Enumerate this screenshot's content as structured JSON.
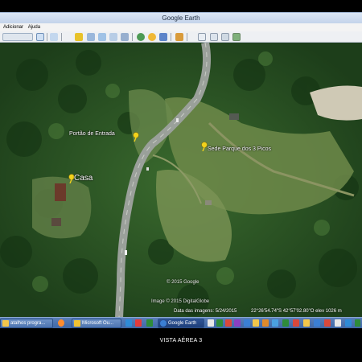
{
  "window": {
    "title": "Google Earth"
  },
  "menu": {
    "items": [
      "Adicionar",
      "Ajuda"
    ]
  },
  "placemarks": {
    "gate": "Portão de Entrada",
    "house": "Casa",
    "hq": "Sede Parque dos 3 Picos"
  },
  "map": {
    "copyright_google": "© 2015 Google",
    "copyright_image": "Image © 2015 DigitalGlobe"
  },
  "status": {
    "imagery_date": "Data das imagens: 5/24/2015",
    "coordinates": "22°26'54.74\"S   42°57'02.80\"O   elev  1026 m"
  },
  "taskbar": {
    "buttons": [
      "atalhos progra...",
      "Microsoft Ou...",
      "Google Earth"
    ]
  },
  "caption": "VISTA AÉREA 3",
  "colors": {
    "pin": "#f2d21b",
    "taskbar": "#4a70ad"
  }
}
